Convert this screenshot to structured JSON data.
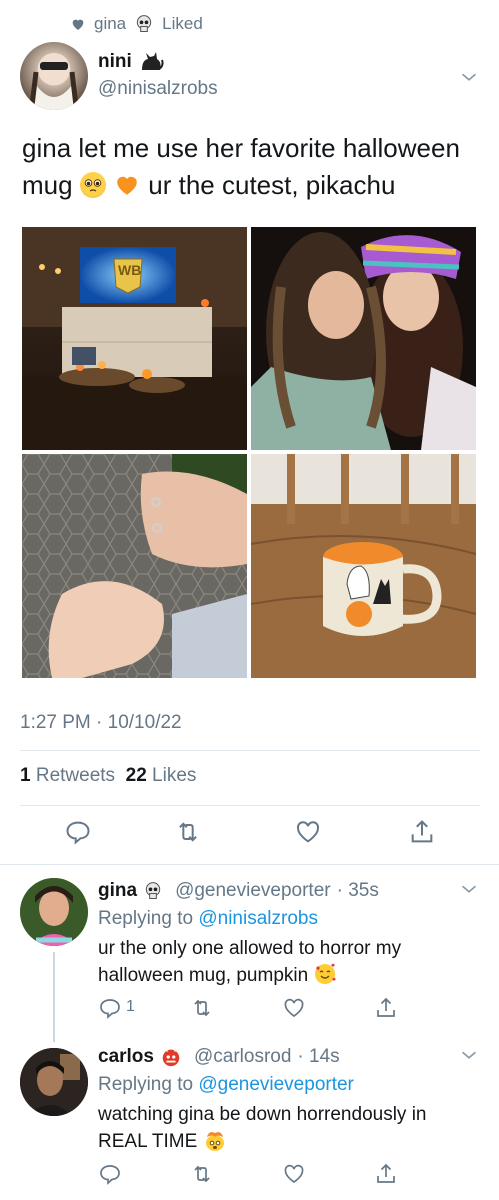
{
  "social_context": {
    "user": "gina",
    "action": "Liked"
  },
  "tweet": {
    "author_name": "nini",
    "author_handle": "@ninisalzrobs",
    "text_line1": "gina let me use her favorite halloween",
    "text_line2_a": "mug",
    "text_line2_b": "ur the cutest, pikachu",
    "timestamp": "1:27 PM · 10/10/22",
    "retweet_count": "1",
    "retweet_label": "Retweets",
    "like_count": "22",
    "like_label": "Likes",
    "media_tv_text": "WB"
  },
  "replies": [
    {
      "name": "gina",
      "handle": "@genevieveporter",
      "time": "· 35s",
      "replying_prefix": "Replying to",
      "replying_to": "@ninisalzrobs",
      "text_line1": "ur the only one allowed to horror my",
      "text_line2": "halloween mug, pumpkin",
      "reply_count": "1"
    },
    {
      "name": "carlos",
      "handle": "@carlosrod",
      "time": "· 14s",
      "replying_prefix": "Replying to",
      "replying_to": "@genevieveporter",
      "text_line1": "watching gina be down horrendously in",
      "text_line2": "REAL TIME"
    }
  ],
  "colors": {
    "accent": "#1b95e0",
    "muted": "#657786",
    "divider": "#e1e8ed",
    "heart_orange": "#f7931e"
  },
  "icons": [
    "heart-icon",
    "skull-icon",
    "cat-icon",
    "chevron-down-icon",
    "pleading-face-icon",
    "orange-heart-icon",
    "reply-icon",
    "retweet-icon",
    "like-icon",
    "share-icon",
    "smiling-hearts-face-icon",
    "ogre-icon",
    "exploding-head-icon"
  ]
}
